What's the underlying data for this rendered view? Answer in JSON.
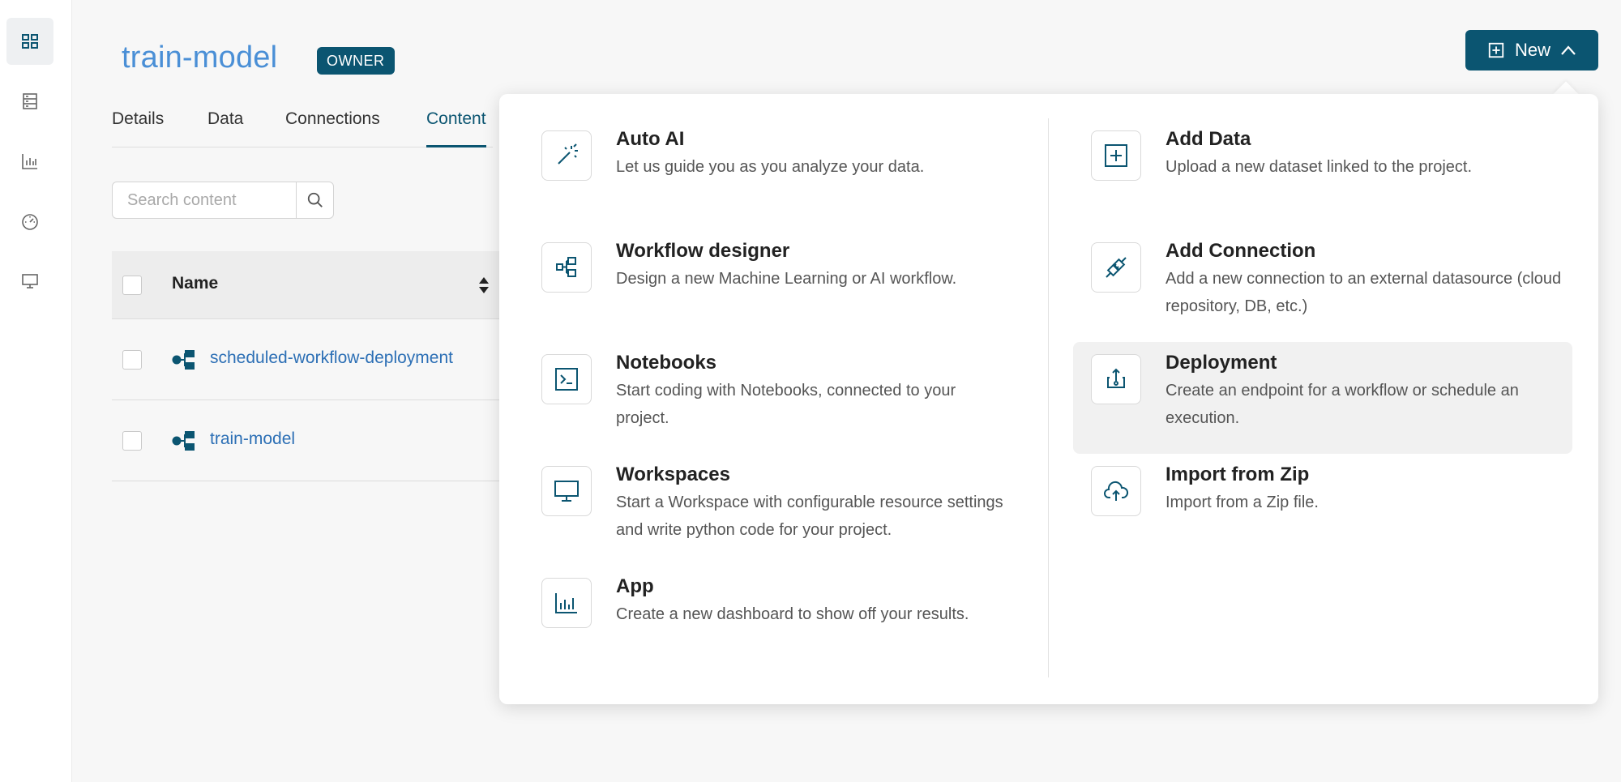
{
  "sidebar": {
    "items": [
      {
        "icon": "dashboard-icon",
        "active": true
      },
      {
        "icon": "storage-icon",
        "active": false
      },
      {
        "icon": "chart-icon",
        "active": false
      },
      {
        "icon": "gauge-icon",
        "active": false
      },
      {
        "icon": "monitor-icon",
        "active": false
      }
    ]
  },
  "header": {
    "title": "train-model",
    "badge": "OWNER"
  },
  "tabs": [
    {
      "label": "Details",
      "active": false
    },
    {
      "label": "Data",
      "active": false
    },
    {
      "label": "Connections",
      "active": false
    },
    {
      "label": "Content",
      "active": true
    }
  ],
  "search": {
    "placeholder": "Search content",
    "value": ""
  },
  "table": {
    "columns": [
      "Name"
    ],
    "rows": [
      {
        "name": "scheduled-workflow-deployment"
      },
      {
        "name": "train-model"
      }
    ]
  },
  "new_button": {
    "label": "New"
  },
  "menu": {
    "left": [
      {
        "title": "Auto AI",
        "desc": "Let us guide you as you analyze your data.",
        "icon": "magic-wand-icon"
      },
      {
        "title": "Workflow designer",
        "desc": "Design a new Machine Learning or AI workflow.",
        "icon": "workflow-icon"
      },
      {
        "title": "Notebooks",
        "desc": "Start coding with Notebooks, connected to your project.",
        "icon": "terminal-icon"
      },
      {
        "title": "Workspaces",
        "desc": "Start a Workspace with configurable resource settings and write python code for your project.",
        "icon": "monitor-icon"
      },
      {
        "title": "App",
        "desc": "Create a new dashboard to show off your results.",
        "icon": "bar-chart-icon"
      }
    ],
    "right": [
      {
        "title": "Add Data",
        "desc": "Upload a new dataset linked to the project.",
        "icon": "plus-square-icon"
      },
      {
        "title": "Add Connection",
        "desc": "Add a new connection to an external datasource (cloud repository, DB, etc.)",
        "icon": "plug-icon"
      },
      {
        "title": "Deployment",
        "desc": "Create an endpoint for a workflow or schedule an execution.",
        "icon": "deploy-icon",
        "hovered": true
      },
      {
        "title": "Import from Zip",
        "desc": "Import from a Zip file.",
        "icon": "cloud-upload-icon"
      }
    ]
  },
  "colors": {
    "accent": "#0b5571",
    "title_blue": "#4a8fd6",
    "link_blue": "#2c6fb5"
  }
}
